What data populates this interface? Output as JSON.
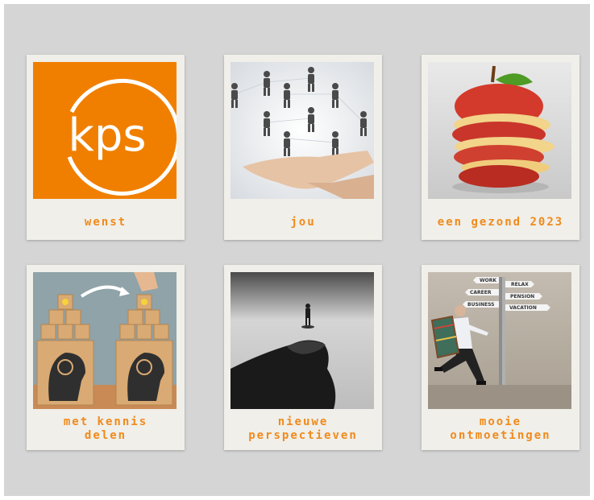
{
  "cards": [
    {
      "caption": "wenst",
      "photo": "kps-logo",
      "logo_text": "kps"
    },
    {
      "caption": "jou",
      "photo": "people-network-hand"
    },
    {
      "caption": "een gezond 2023",
      "photo": "sliced-apple"
    },
    {
      "caption": "met kennis\ndelen",
      "photo": "wooden-blocks-knowledge"
    },
    {
      "caption": "nieuwe\nperspectieven",
      "photo": "tiny-person-on-hand"
    },
    {
      "caption": "mooie\nontmoetingen",
      "photo": "businessman-running-signpost",
      "signs": [
        "WORK",
        "CAREER",
        "BUSINESS",
        "RELAX",
        "PENSION",
        "VACATION"
      ]
    }
  ],
  "colors": {
    "accent": "#f08a1c",
    "kps_orange": "#f07f00",
    "board": "#d5d5d5",
    "card": "#f0efe9"
  }
}
